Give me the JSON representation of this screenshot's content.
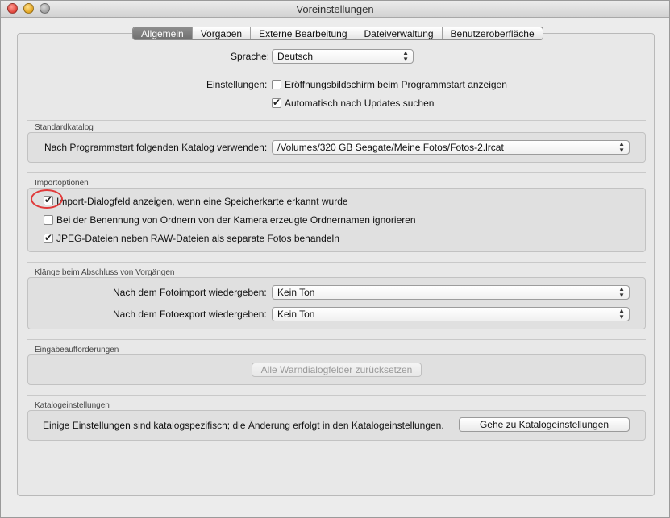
{
  "window": {
    "title": "Voreinstellungen"
  },
  "tabs": [
    {
      "label": "Allgemein",
      "active": true
    },
    {
      "label": "Vorgaben",
      "active": false
    },
    {
      "label": "Externe Bearbeitung",
      "active": false
    },
    {
      "label": "Dateiverwaltung",
      "active": false
    },
    {
      "label": "Benutzeroberfläche",
      "active": false
    }
  ],
  "general": {
    "language_label": "Sprache:",
    "language_value": "Deutsch",
    "settings_label": "Einstellungen:",
    "splash_label": "Eröffnungsbildschirm beim Programmstart anzeigen",
    "splash_checked": false,
    "updates_label": "Automatisch nach Updates suchen",
    "updates_checked": true
  },
  "standard_catalog": {
    "title": "Standardkatalog",
    "label": "Nach Programmstart folgenden Katalog verwenden:",
    "value": "/Volumes/320 GB Seagate/Meine Fotos/Fotos-2.lrcat"
  },
  "import_options": {
    "title": "Importoptionen",
    "items": [
      {
        "label": "Import-Dialogfeld anzeigen, wenn eine Speicherkarte erkannt wurde",
        "checked": true
      },
      {
        "label": "Bei der Benennung von Ordnern von der Kamera erzeugte Ordnernamen ignorieren",
        "checked": false
      },
      {
        "label": "JPEG-Dateien neben RAW-Dateien als separate Fotos behandeln",
        "checked": true
      }
    ]
  },
  "sounds": {
    "title": "Klänge beim Abschluss von Vorgängen",
    "import_label": "Nach dem Fotoimport wiedergeben:",
    "import_value": "Kein Ton",
    "export_label": "Nach dem Fotoexport wiedergeben:",
    "export_value": "Kein Ton"
  },
  "prompts": {
    "title": "Eingabeaufforderungen",
    "reset_button": "Alle Warndialogfelder zurücksetzen"
  },
  "catalog_settings": {
    "title": "Katalogeinstellungen",
    "text": "Einige Einstellungen sind katalogspezifisch; die Änderung erfolgt in den Katalogeinstellungen.",
    "button": "Gehe zu Katalogeinstellungen"
  },
  "annotation": {
    "color": "#e03a3a"
  }
}
